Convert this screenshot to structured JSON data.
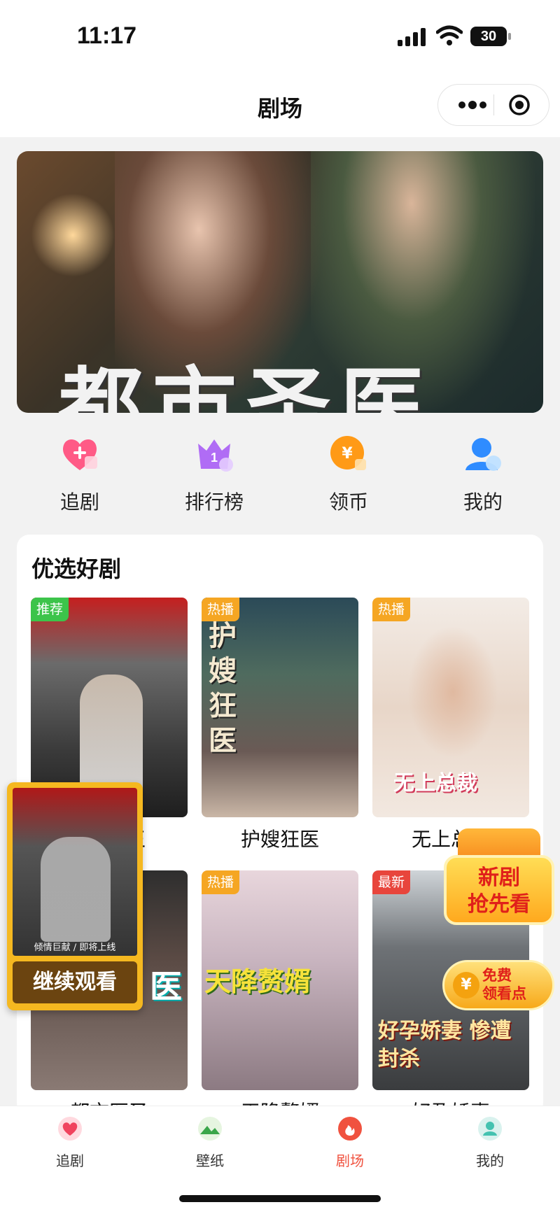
{
  "status_bar": {
    "time": "11:17",
    "battery": "30"
  },
  "nav": {
    "title": "剧场"
  },
  "banner": {
    "title": "都市圣医"
  },
  "shortcuts": [
    {
      "label": "追剧",
      "icon": "heart-plus-icon",
      "color": "#ff5a86"
    },
    {
      "label": "排行榜",
      "icon": "crown-icon",
      "color": "#9b5cf6"
    },
    {
      "label": "领币",
      "icon": "coin-icon",
      "color": "#ff9a16"
    },
    {
      "label": "我的",
      "icon": "user-icon",
      "color": "#2f8cff"
    }
  ],
  "section": {
    "title": "优选好剧",
    "cards": [
      {
        "tag": "推荐",
        "tag_color": "#3cc44a",
        "name": "王",
        "poster_text": ""
      },
      {
        "tag": "热播",
        "tag_color": "#f5a623",
        "name": "护嫂狂医",
        "poster_text": "护嫂狂医"
      },
      {
        "tag": "热播",
        "tag_color": "#f5a623",
        "name": "无上总裁",
        "poster_text": "无上总裁"
      },
      {
        "tag": "",
        "tag_color": "",
        "name": "都市医圣",
        "poster_text": "医"
      },
      {
        "tag": "热播",
        "tag_color": "#f5a623",
        "name": "天降赘婿",
        "poster_text": "天降赘婿"
      },
      {
        "tag": "最新",
        "tag_color": "#e8453c",
        "name": "好孕娇妻",
        "poster_text": "好孕娇妻 惨遭封杀"
      }
    ]
  },
  "continue_watching": {
    "label": "继续观看",
    "poster_text": "倾情巨献 / 即将上线"
  },
  "promo": {
    "line1": "新剧",
    "line2": "抢先看"
  },
  "free_coins": {
    "coin": "¥",
    "line1": "免费",
    "line2": "领看点"
  },
  "tabbar": [
    {
      "label": "追剧",
      "icon": "heart-icon",
      "active": false
    },
    {
      "label": "壁纸",
      "icon": "wallpaper-icon",
      "active": false
    },
    {
      "label": "剧场",
      "icon": "flame-icon",
      "active": true
    },
    {
      "label": "我的",
      "icon": "profile-icon",
      "active": false
    }
  ],
  "colors": {
    "accent": "#f0523f",
    "primary_text": "#111111",
    "tab_inactive": "#333333"
  }
}
